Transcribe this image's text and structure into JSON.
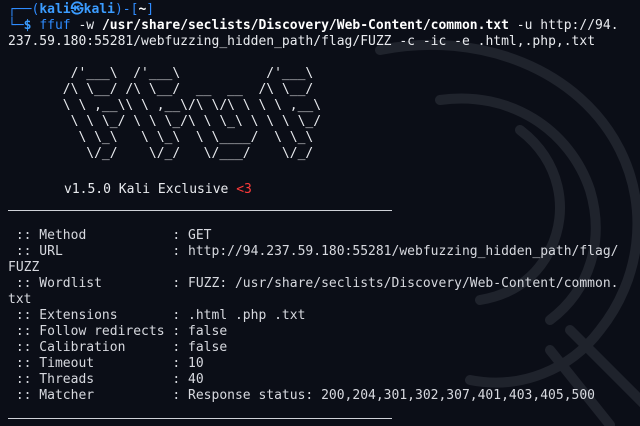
{
  "prompt": {
    "corner_top": "┌──(",
    "user": "kali",
    "at_symbol": "㉿",
    "host": "kali",
    "mid": ")-[",
    "path": "~",
    "end": "]",
    "corner_bottom": "└─",
    "dollar": "$",
    "cmd_prog": "ffuf",
    "cmd_flag_w": "-w",
    "cmd_wordlist": "/usr/share/seclists/Discovery/Web-Content/common.txt",
    "cmd_flag_u": "-u",
    "cmd_url_part1": "http://94.",
    "cmd_url_part2": "237.59.180:55281/webfuzzing_hidden_path/flag/FUZZ",
    "cmd_flag_c": "-c",
    "cmd_flag_ic": "-ic",
    "cmd_flag_e": "-e",
    "cmd_ext": ".html,.php,.txt"
  },
  "banner": {
    "lines": [
      "        /'___\\  /'___\\           /'___\\",
      "       /\\ \\__/ /\\ \\__/  __  __  /\\ \\__/",
      "       \\ \\ ,__\\\\ \\ ,__\\/\\ \\/\\ \\ \\ \\ ,__\\",
      "        \\ \\ \\_/ \\ \\ \\_/\\ \\ \\_\\ \\ \\ \\ \\_/",
      "         \\ \\_\\   \\ \\_\\  \\ \\____/  \\ \\_\\",
      "          \\/_/    \\/_/   \\/___/    \\/_/"
    ],
    "version": "v1.5.0 Kali Exclusive",
    "heart": "<3"
  },
  "config": {
    "method_key": " :: Method           : ",
    "method_val": "GET",
    "url_key": " :: URL              : ",
    "url_val1": "http://94.237.59.180:55281/webfuzzing_hidden_path/flag/",
    "url_val2": "FUZZ",
    "wordlist_key": " :: Wordlist         : ",
    "wordlist_val1": "FUZZ: /usr/share/seclists/Discovery/Web-Content/common.",
    "wordlist_val2": "txt",
    "ext_key": " :: Extensions       : ",
    "ext_val": ".html .php .txt",
    "follow_key": " :: Follow redirects : ",
    "follow_val": "false",
    "calib_key": " :: Calibration      : ",
    "calib_val": "false",
    "timeout_key": " :: Timeout          : ",
    "timeout_val": "10",
    "threads_key": " :: Threads          : ",
    "threads_val": "40",
    "matcher_key": " :: Matcher          : ",
    "matcher_val": "Response status: 200,204,301,302,307,401,403,405,500"
  },
  "colors": {
    "background": "#0b0e17",
    "prompt_blue": "#2f8cff",
    "heart_red": "#ff3b3b"
  }
}
